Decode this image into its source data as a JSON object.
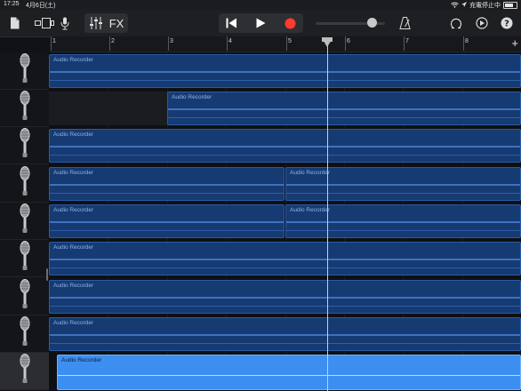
{
  "status_bar": {
    "time": "17:25",
    "date": "4月6日(土)",
    "charging": "充電停止中"
  },
  "toolbar": {
    "fx_label": "FX"
  },
  "ruler": {
    "bars": [
      "1",
      "2",
      "3",
      "4",
      "5",
      "6",
      "7",
      "8"
    ],
    "add_label": "+"
  },
  "tracks": [
    {
      "regions": [
        {
          "label": "Audio Recorder"
        }
      ]
    },
    {
      "regions": [
        {
          "label": "Audio Recorder"
        }
      ]
    },
    {
      "regions": [
        {
          "label": "Audio Recorder"
        }
      ]
    },
    {
      "regions": [
        {
          "label": "Audio Recorder"
        },
        {
          "label": "Audio Recorder"
        }
      ]
    },
    {
      "regions": [
        {
          "label": "Audio Recorder"
        },
        {
          "label": "Audio Recorder"
        }
      ]
    },
    {
      "regions": [
        {
          "label": "Audio Recorder"
        }
      ]
    },
    {
      "regions": [
        {
          "label": "Audio Recorder"
        }
      ]
    },
    {
      "regions": [
        {
          "label": "Audio Recorder"
        }
      ]
    },
    {
      "regions": [
        {
          "label": "Audio Recorder"
        }
      ]
    }
  ],
  "colors": {
    "region": "#163a72",
    "region_selected": "#3c8ff0",
    "record": "#ff3b30"
  }
}
